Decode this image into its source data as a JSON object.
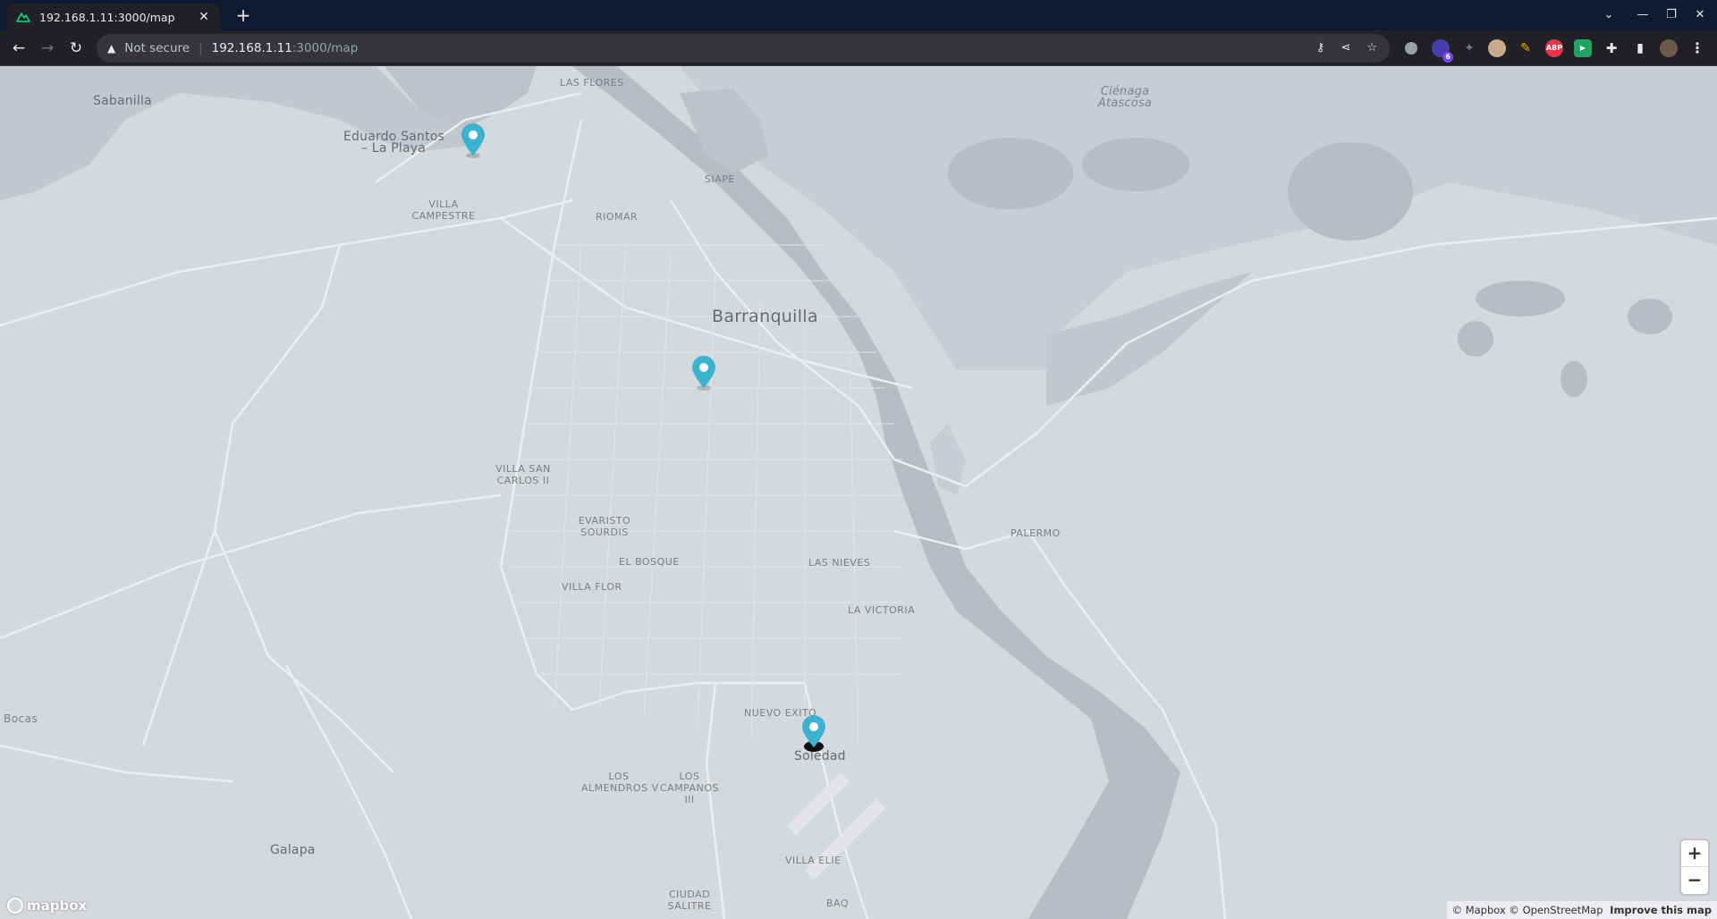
{
  "browser": {
    "tab_title": "192.168.1.11:3000/map",
    "url_security": "Not secure",
    "url_host": "192.168.1.11",
    "url_path": ":3000/map",
    "extension_badge": "6"
  },
  "map": {
    "labels": {
      "sabanilla": "Sabanilla",
      "las_flores": "LAS FLORES",
      "eduardo_santos_1": "Eduardo Santos",
      "eduardo_santos_2": "– La Playa",
      "cienaga_1": "Ciénaga",
      "cienaga_2": "Atascosa",
      "siape": "SIAPE",
      "villa_campestre_1": "VILLA",
      "villa_campestre_2": "CAMPESTRE",
      "riomar": "RIOMAR",
      "barranquilla": "Barranquilla",
      "villa_san_carlos_1": "VILLA SAN",
      "villa_san_carlos_2": "CARLOS II",
      "evaristo_sourdis_1": "EVARISTO",
      "evaristo_sourdis_2": "SOURDIS",
      "palermo": "PALERMO",
      "el_bosque": "EL BOSQUE",
      "las_nieves": "LAS NIEVES",
      "villa_flor": "VILLA FLOR",
      "la_victoria": "LA VICTORIA",
      "bocas": "Bocas",
      "nuevo_exito": "NUEVO EXITO",
      "soledad": "Soledad",
      "los_almendros_1": "LOS",
      "los_almendros_2": "ALMENDROS V",
      "los_campanos_1": "LOS",
      "los_campanos_2": "CAMPANOS",
      "los_campanos_3": "III",
      "galapa": "Galapa",
      "villa_elie": "VILLA ELIE",
      "ciudad_salitre_1": "CIUDAD",
      "ciudad_salitre_2": "SALITRE",
      "baq": "BAQ"
    },
    "zoom_in": "+",
    "zoom_out": "−",
    "logo": "mapbox",
    "attribution": "© Mapbox © OpenStreetMap",
    "improve": "Improve this map",
    "colors": {
      "land": "#d5d8dd",
      "water": "#b8bcc3",
      "road": "#eceef1",
      "marker": "#3bb2d0"
    }
  }
}
